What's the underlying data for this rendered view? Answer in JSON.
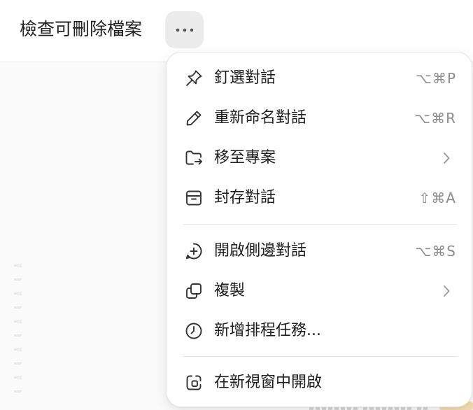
{
  "header": {
    "title": "檢查可刪除檔案",
    "more_icon": "more-horizontal-icon"
  },
  "menu": {
    "items": [
      {
        "label": "釘選對話",
        "shortcut": "⌥⌘P",
        "icon": "pin-icon"
      },
      {
        "label": "重新命名對話",
        "shortcut": "⌥⌘R",
        "icon": "pencil-icon"
      },
      {
        "label": "移至專案",
        "icon": "folder-move-icon",
        "submenu": true
      },
      {
        "label": "封存對話",
        "shortcut": "⇧⌘A",
        "icon": "archive-icon"
      },
      {
        "label": "開啟側邊對話",
        "shortcut": "⌥⌘S",
        "icon": "plus-circle-icon"
      },
      {
        "label": "複製",
        "icon": "copy-icon",
        "submenu": true
      },
      {
        "label": "新增排程任務...",
        "icon": "clock-icon"
      },
      {
        "label": "在新視窗中開啟",
        "icon": "new-window-icon"
      }
    ]
  },
  "colors": {
    "menu_bg": "#ffffff",
    "text": "#1e1e1e",
    "shortcut": "#8c8c8c",
    "more_button_bg": "#ececec"
  }
}
